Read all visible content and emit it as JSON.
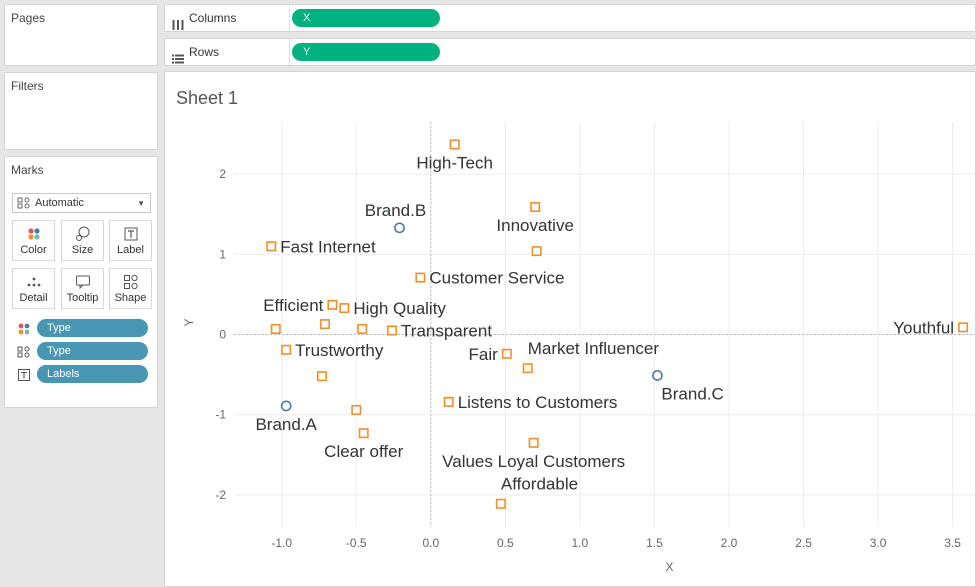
{
  "pages": {
    "title": "Pages"
  },
  "filters": {
    "title": "Filters"
  },
  "marks": {
    "title": "Marks",
    "mark_type": "Automatic",
    "buttons": [
      {
        "id": "color",
        "label": "Color"
      },
      {
        "id": "size",
        "label": "Size"
      },
      {
        "id": "label",
        "label": "Label"
      },
      {
        "id": "detail",
        "label": "Detail"
      },
      {
        "id": "tooltip",
        "label": "Tooltip"
      },
      {
        "id": "shape",
        "label": "Shape"
      }
    ],
    "pills": [
      {
        "encoding": "color",
        "field": "Type"
      },
      {
        "encoding": "shape",
        "field": "Type"
      },
      {
        "encoding": "label",
        "field": "Labels"
      }
    ]
  },
  "shelves": {
    "columns": {
      "label": "Columns",
      "field": "X"
    },
    "rows": {
      "label": "Rows",
      "field": "Y"
    }
  },
  "sheet": {
    "title": "Sheet 1"
  },
  "chart_data": {
    "type": "scatter",
    "xlabel": "X",
    "ylabel": "Y",
    "xlim": [
      -1.32,
      3.65
    ],
    "ylim": [
      -2.4,
      2.65
    ],
    "xticks": [
      "-1.0",
      "-0.5",
      "0.0",
      "0.5",
      "1.0",
      "1.5",
      "2.0",
      "2.5",
      "3.0",
      "3.5"
    ],
    "xtick_values": [
      -1.0,
      -0.5,
      0.0,
      0.5,
      1.0,
      1.5,
      2.0,
      2.5,
      3.0,
      3.5
    ],
    "yticks": [
      "2",
      "1",
      "0",
      "-1",
      "-2"
    ],
    "ytick_values": [
      2,
      1,
      0,
      -1,
      -2
    ],
    "grid": true,
    "colors": {
      "brand": "#4e79a7",
      "attribute": "#f28e2b",
      "grid": "#ececec",
      "zero": "#bdbdbd",
      "tick": "#666666",
      "label": "#333333"
    },
    "points": [
      {
        "label": "High-Tech",
        "x": 0.16,
        "y": 2.37,
        "kind": "attribute",
        "label_pos": "below"
      },
      {
        "label": "Brand.B",
        "x": -0.21,
        "y": 1.33,
        "kind": "brand",
        "label_pos": "above-left"
      },
      {
        "label": "Innovative",
        "x": 0.7,
        "y": 1.59,
        "kind": "attribute",
        "label_pos": "below"
      },
      {
        "label": "",
        "x": 0.71,
        "y": 1.04,
        "kind": "attribute",
        "label_pos": "none"
      },
      {
        "label": "Fast Internet",
        "x": -1.07,
        "y": 1.1,
        "kind": "attribute",
        "label_pos": "right"
      },
      {
        "label": "Customer Service",
        "x": -0.07,
        "y": 0.71,
        "kind": "attribute",
        "label_pos": "right"
      },
      {
        "label": "Efficient",
        "x": -0.66,
        "y": 0.37,
        "kind": "attribute",
        "label_pos": "left"
      },
      {
        "label": "High Quality",
        "x": -0.58,
        "y": 0.33,
        "kind": "attribute",
        "label_pos": "right"
      },
      {
        "label": "",
        "x": -1.04,
        "y": 0.07,
        "kind": "attribute",
        "label_pos": "none"
      },
      {
        "label": "",
        "x": -0.71,
        "y": 0.13,
        "kind": "attribute",
        "label_pos": "none"
      },
      {
        "label": "",
        "x": -0.46,
        "y": 0.07,
        "kind": "attribute",
        "label_pos": "none"
      },
      {
        "label": "Transparent",
        "x": -0.26,
        "y": 0.05,
        "kind": "attribute",
        "label_pos": "right"
      },
      {
        "label": "Trustworthy",
        "x": -0.97,
        "y": -0.19,
        "kind": "attribute",
        "label_pos": "right"
      },
      {
        "label": "Fair",
        "x": 0.51,
        "y": -0.24,
        "kind": "attribute",
        "label_pos": "left"
      },
      {
        "label": "Market Influencer",
        "x": 0.65,
        "y": -0.42,
        "kind": "attribute",
        "label_pos": "above-right"
      },
      {
        "label": "",
        "x": -0.73,
        "y": -0.52,
        "kind": "attribute",
        "label_pos": "none"
      },
      {
        "label": "Brand.C",
        "x": 1.52,
        "y": -0.51,
        "kind": "brand",
        "label_pos": "below-right"
      },
      {
        "label": "Youthful",
        "x": 3.57,
        "y": 0.09,
        "kind": "attribute",
        "label_pos": "left"
      },
      {
        "label": "Brand.A",
        "x": -0.97,
        "y": -0.89,
        "kind": "brand",
        "label_pos": "below"
      },
      {
        "label": "",
        "x": -0.5,
        "y": -0.94,
        "kind": "attribute",
        "label_pos": "none"
      },
      {
        "label": "Listens to Customers",
        "x": 0.12,
        "y": -0.84,
        "kind": "attribute",
        "label_pos": "right"
      },
      {
        "label": "Clear offer",
        "x": -0.45,
        "y": -1.23,
        "kind": "attribute",
        "label_pos": "below"
      },
      {
        "label": "Values Loyal Customers",
        "x": 0.69,
        "y": -1.35,
        "kind": "attribute",
        "label_pos": "below"
      },
      {
        "label": "Affordable",
        "x": 0.47,
        "y": -2.11,
        "kind": "attribute",
        "label_pos": "above-right"
      }
    ]
  }
}
